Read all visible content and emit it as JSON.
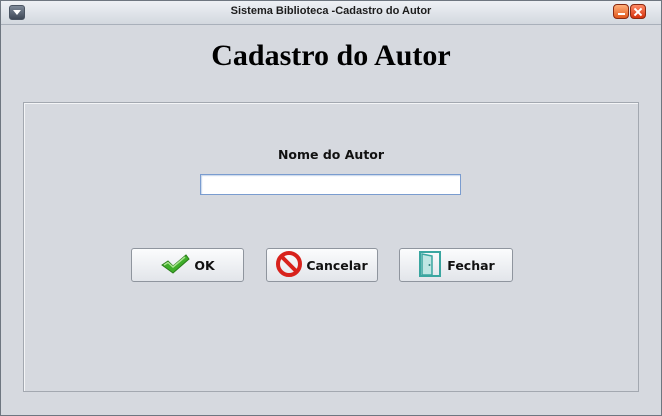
{
  "window": {
    "title": "Sistema Biblioteca -Cadastro do Autor"
  },
  "form": {
    "heading": "Cadastro do Autor",
    "author_label": "Nome do Autor",
    "author_value": ""
  },
  "buttons": {
    "ok": {
      "label": "OK",
      "icon": "checkmark-icon"
    },
    "cancel": {
      "label": "Cancelar",
      "icon": "no-entry-icon"
    },
    "close": {
      "label": "Fechar",
      "icon": "door-icon"
    }
  },
  "colors": {
    "window_bg": "#d6d9df",
    "checkmark": "#3fae2a",
    "cancel_red": "#d8221c",
    "door_teal": "#3aa6a0"
  }
}
